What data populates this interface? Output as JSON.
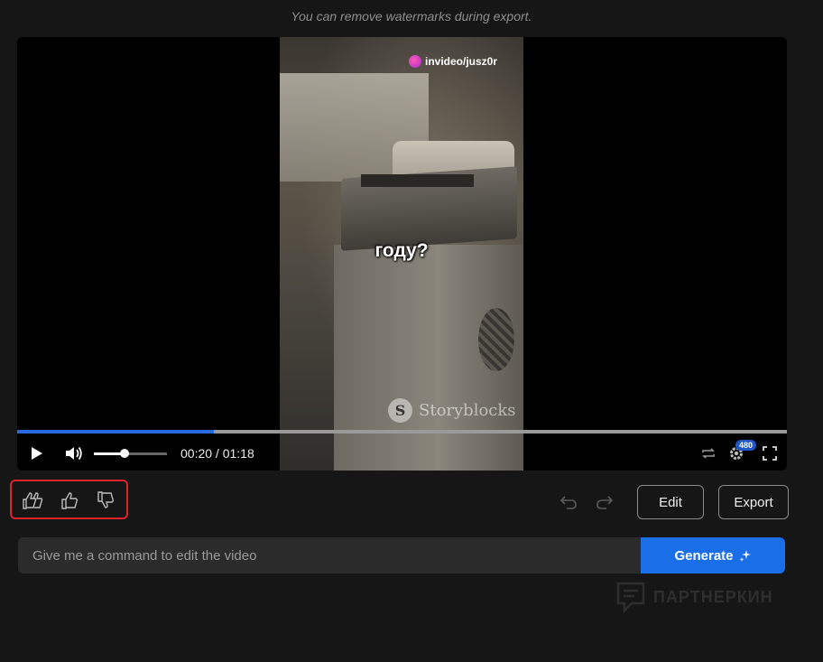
{
  "hint": "You can remove watermarks during export.",
  "video": {
    "watermark_top": "invideo/jusz0r",
    "caption": "году?",
    "stock_watermark": "Storyblocks",
    "stock_logo_letter": "S",
    "progress": 0.256,
    "volume": 0.42,
    "time_display": "00:20 / 01:18",
    "quality": "480"
  },
  "feedback": {
    "icons": [
      "double-thumbs-up-icon",
      "thumbs-up-icon",
      "thumbs-down-icon"
    ]
  },
  "toolbar": {
    "edit_label": "Edit",
    "export_label": "Export"
  },
  "command": {
    "placeholder": "Give me a command to edit the video",
    "generate_label": "Generate"
  },
  "corner_watermark": "ПАРТНЕРКИН"
}
